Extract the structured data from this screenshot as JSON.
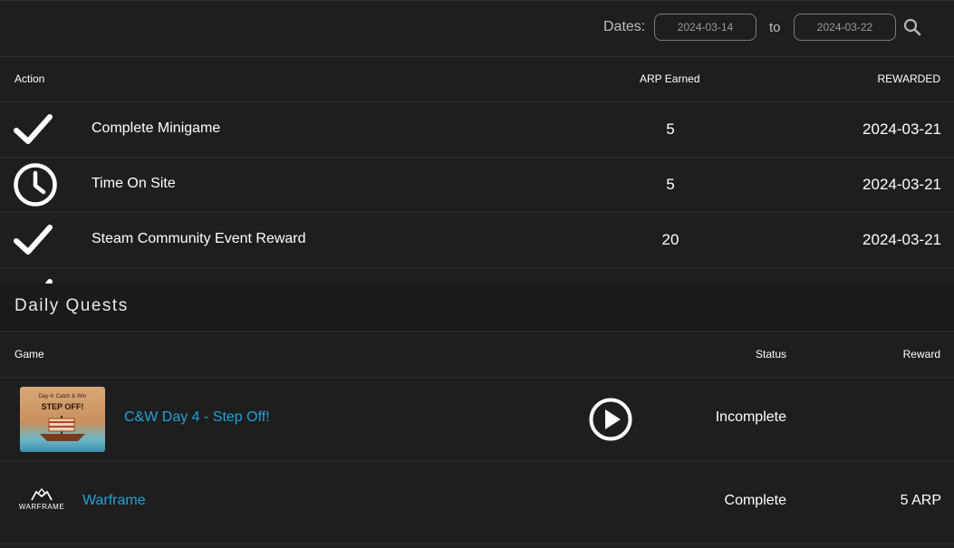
{
  "filters": {
    "dates_label": "Dates:",
    "from_date": "2024-03-14",
    "to_label": "to",
    "to_date": "2024-03-22"
  },
  "activity": {
    "headers": {
      "action": "Action",
      "arp": "ARP Earned",
      "rewarded": "REWARDED"
    },
    "rows": [
      {
        "icon": "checkmark-icon",
        "action": "Complete Minigame",
        "arp": "5",
        "date": "2024-03-21"
      },
      {
        "icon": "clock-icon",
        "action": "Time On Site",
        "arp": "5",
        "date": "2024-03-21"
      },
      {
        "icon": "checkmark-icon",
        "action": "Steam Community Event Reward",
        "arp": "20",
        "date": "2024-03-21"
      }
    ]
  },
  "quests": {
    "title": "Daily Quests",
    "headers": {
      "game": "Game",
      "status": "Status",
      "reward": "Reward"
    },
    "rows": [
      {
        "thumb_caption": "Day 4: Catch & Win",
        "thumb_title": "STEP OFF!",
        "name": "C&W Day 4 - Step Off!",
        "status": "Incomplete",
        "reward": ""
      },
      {
        "logo_text": "WARFRAME",
        "name": "Warframe",
        "status": "Complete",
        "reward": "5 ARP"
      }
    ]
  },
  "colors": {
    "link": "#1fa3d9",
    "background": "#1e1e1e",
    "divider": "#2b2b2b"
  }
}
